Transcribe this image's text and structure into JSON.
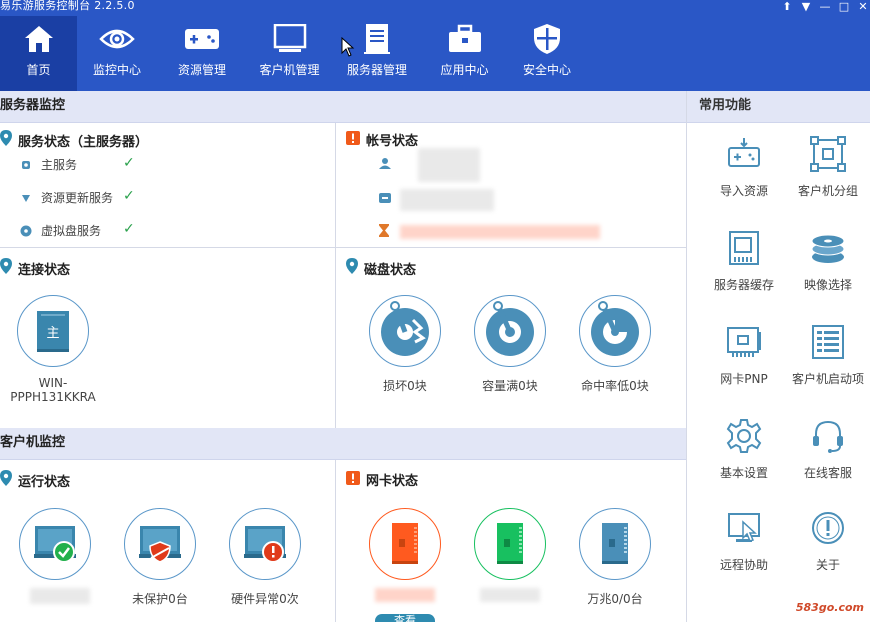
{
  "app": {
    "title": "易乐游服务控制台 2.2.5.0",
    "window_controls": [
      "⬆",
      "▼",
      "—",
      "□",
      "✕"
    ]
  },
  "nav": [
    {
      "label": "首页",
      "icon": "home-icon",
      "active": true
    },
    {
      "label": "监控中心",
      "icon": "eye-icon"
    },
    {
      "label": "资源管理",
      "icon": "gamepad-icon"
    },
    {
      "label": "客户机管理",
      "icon": "monitor-icon"
    },
    {
      "label": "服务器管理",
      "icon": "server-icon"
    },
    {
      "label": "应用中心",
      "icon": "toolbox-icon"
    },
    {
      "label": "安全中心",
      "icon": "shield-icon"
    }
  ],
  "server_monitor": {
    "header": "服务器监控",
    "service_status": {
      "title": "服务状态（主服务器）",
      "items": [
        {
          "label": "主服务",
          "icon": "dot-icon"
        },
        {
          "label": "资源更新服务",
          "icon": "arrow-down-icon"
        },
        {
          "label": "虚拟盘服务",
          "icon": "disc-icon"
        }
      ]
    },
    "account_status": {
      "title": "帐号状态"
    },
    "connection_status": {
      "title": "连接状态",
      "server_glyph": "主",
      "server_name": "WIN-PPPH131KKRA"
    },
    "disk_status": {
      "title": "磁盘状态",
      "items": [
        {
          "label": "损坏0块",
          "icon": "disk-broken-icon"
        },
        {
          "label": "容量满0块",
          "icon": "disk-full-icon"
        },
        {
          "label": "命中率低0块",
          "icon": "disk-hitrate-icon"
        }
      ]
    }
  },
  "client_monitor": {
    "header": "客户机监控",
    "run_status": {
      "title": "运行状态",
      "items": [
        {
          "label": "",
          "icon": "monitor-ok-icon"
        },
        {
          "label": "未保护0台",
          "icon": "monitor-unprotected-icon"
        },
        {
          "label": "硬件异常0次",
          "icon": "monitor-error-icon"
        }
      ]
    },
    "nic_status": {
      "title": "网卡状态",
      "items": [
        {
          "label": "",
          "color": "#ff5a1f"
        },
        {
          "label": "",
          "color": "#18c060"
        },
        {
          "label": "万兆0/0台",
          "color": "#4a8fb8"
        }
      ],
      "view_button": "查看"
    }
  },
  "common_functions": {
    "header": "常用功能",
    "items": [
      {
        "label": "导入资源",
        "icon": "import-gamepad-icon"
      },
      {
        "label": "客户机分组",
        "icon": "group-icon"
      },
      {
        "label": "服务器缓存",
        "icon": "memory-icon"
      },
      {
        "label": "映像选择",
        "icon": "disk-stack-icon"
      },
      {
        "label": "网卡PNP",
        "icon": "network-card-icon"
      },
      {
        "label": "客户机启动项",
        "icon": "startup-list-icon"
      },
      {
        "label": "基本设置",
        "icon": "gear-icon"
      },
      {
        "label": "在线客服",
        "icon": "headset-icon"
      },
      {
        "label": "远程协助",
        "icon": "remote-icon"
      },
      {
        "label": "关于",
        "icon": "info-icon"
      }
    ]
  },
  "watermark": "583go.com"
}
